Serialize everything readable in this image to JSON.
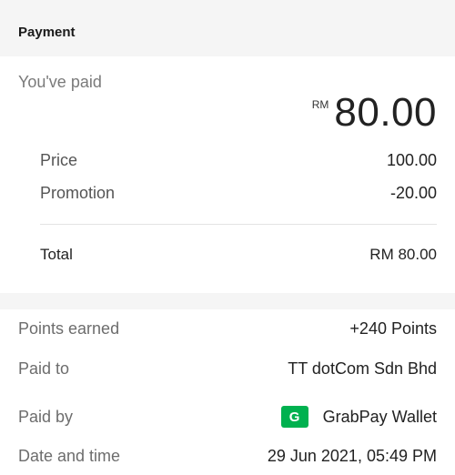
{
  "header": {
    "title": "Payment"
  },
  "summary": {
    "paid_label": "You've paid",
    "currency": "RM",
    "amount": "80.00",
    "lines": [
      {
        "label": "Price",
        "value": "100.00"
      },
      {
        "label": "Promotion",
        "value": "-20.00"
      }
    ],
    "total": {
      "label": "Total",
      "value": "RM 80.00"
    }
  },
  "details": {
    "points": {
      "label": "Points earned",
      "value": "+240 Points"
    },
    "paid_to": {
      "label": "Paid to",
      "value": "TT dotCom Sdn Bhd"
    },
    "paid_by": {
      "label": "Paid by",
      "value": "GrabPay Wallet",
      "icon_letter": "G",
      "icon": "grabpay-wallet-icon",
      "icon_color": "#00b14f"
    },
    "date_time": {
      "label": "Date and time",
      "value": "29 Jun 2021, 05:49 PM"
    }
  }
}
